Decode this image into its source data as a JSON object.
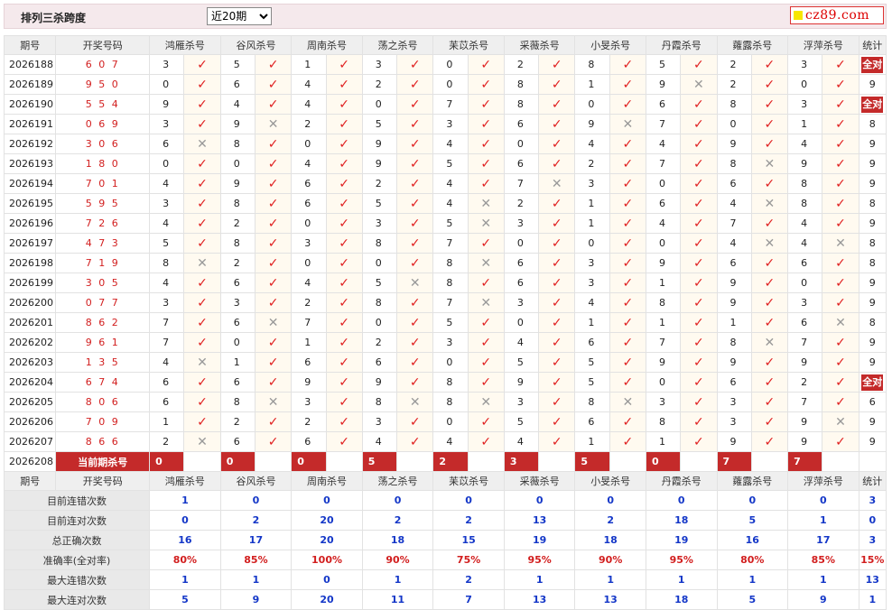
{
  "header": {
    "title": "排列三杀跨度",
    "period_select": "近20期",
    "logo_text": "cz89.com"
  },
  "columns": {
    "issue": "期号",
    "open": "开奖号码",
    "experts": [
      "鸿雁杀号",
      "谷风杀号",
      "周南杀号",
      "荡之杀号",
      "苿苡杀号",
      "采薇杀号",
      "小旻杀号",
      "丹霞杀号",
      "蕹露杀号",
      "浮萍杀号"
    ],
    "stat": "统计"
  },
  "rows": [
    {
      "issue": "2026188",
      "open": "6 0 7",
      "k": [
        [
          "3",
          1
        ],
        [
          "5",
          1
        ],
        [
          "1",
          1
        ],
        [
          "3",
          1
        ],
        [
          "0",
          1
        ],
        [
          "2",
          1
        ],
        [
          "8",
          1
        ],
        [
          "5",
          1
        ],
        [
          "2",
          1
        ],
        [
          "3",
          1
        ]
      ],
      "stat": "全对"
    },
    {
      "issue": "2026189",
      "open": "9 5 0",
      "k": [
        [
          "0",
          1
        ],
        [
          "6",
          1
        ],
        [
          "4",
          1
        ],
        [
          "2",
          1
        ],
        [
          "0",
          1
        ],
        [
          "8",
          1
        ],
        [
          "1",
          1
        ],
        [
          "9",
          0
        ],
        [
          "2",
          1
        ],
        [
          "0",
          1
        ]
      ],
      "stat": "9"
    },
    {
      "issue": "2026190",
      "open": "5 5 4",
      "k": [
        [
          "9",
          1
        ],
        [
          "4",
          1
        ],
        [
          "4",
          1
        ],
        [
          "0",
          1
        ],
        [
          "7",
          1
        ],
        [
          "8",
          1
        ],
        [
          "0",
          1
        ],
        [
          "6",
          1
        ],
        [
          "8",
          1
        ],
        [
          "3",
          1
        ]
      ],
      "stat": "全对"
    },
    {
      "issue": "2026191",
      "open": "0 6 9",
      "k": [
        [
          "3",
          1
        ],
        [
          "9",
          0
        ],
        [
          "2",
          1
        ],
        [
          "5",
          1
        ],
        [
          "3",
          1
        ],
        [
          "6",
          1
        ],
        [
          "9",
          0
        ],
        [
          "7",
          1
        ],
        [
          "0",
          1
        ],
        [
          "1",
          1
        ]
      ],
      "stat": "8"
    },
    {
      "issue": "2026192",
      "open": "3 0 6",
      "k": [
        [
          "6",
          0
        ],
        [
          "8",
          1
        ],
        [
          "0",
          1
        ],
        [
          "9",
          1
        ],
        [
          "4",
          1
        ],
        [
          "0",
          1
        ],
        [
          "4",
          1
        ],
        [
          "4",
          1
        ],
        [
          "9",
          1
        ],
        [
          "4",
          1
        ]
      ],
      "stat": "9"
    },
    {
      "issue": "2026193",
      "open": "1 8 0",
      "k": [
        [
          "0",
          1
        ],
        [
          "0",
          1
        ],
        [
          "4",
          1
        ],
        [
          "9",
          1
        ],
        [
          "5",
          1
        ],
        [
          "6",
          1
        ],
        [
          "2",
          1
        ],
        [
          "7",
          1
        ],
        [
          "8",
          0
        ],
        [
          "9",
          1
        ]
      ],
      "stat": "9"
    },
    {
      "issue": "2026194",
      "open": "7 0 1",
      "k": [
        [
          "4",
          1
        ],
        [
          "9",
          1
        ],
        [
          "6",
          1
        ],
        [
          "2",
          1
        ],
        [
          "4",
          1
        ],
        [
          "7",
          0
        ],
        [
          "3",
          1
        ],
        [
          "0",
          1
        ],
        [
          "6",
          1
        ],
        [
          "8",
          1
        ]
      ],
      "stat": "9"
    },
    {
      "issue": "2026195",
      "open": "5 9 5",
      "k": [
        [
          "3",
          1
        ],
        [
          "8",
          1
        ],
        [
          "6",
          1
        ],
        [
          "5",
          1
        ],
        [
          "4",
          0
        ],
        [
          "2",
          1
        ],
        [
          "1",
          1
        ],
        [
          "6",
          1
        ],
        [
          "4",
          0
        ],
        [
          "8",
          1
        ]
      ],
      "stat": "8"
    },
    {
      "issue": "2026196",
      "open": "7 2 6",
      "k": [
        [
          "4",
          1
        ],
        [
          "2",
          1
        ],
        [
          "0",
          1
        ],
        [
          "3",
          1
        ],
        [
          "5",
          0
        ],
        [
          "3",
          1
        ],
        [
          "1",
          1
        ],
        [
          "4",
          1
        ],
        [
          "7",
          1
        ],
        [
          "4",
          1
        ]
      ],
      "stat": "9"
    },
    {
      "issue": "2026197",
      "open": "4 7 3",
      "k": [
        [
          "5",
          1
        ],
        [
          "8",
          1
        ],
        [
          "3",
          1
        ],
        [
          "8",
          1
        ],
        [
          "7",
          1
        ],
        [
          "0",
          1
        ],
        [
          "0",
          1
        ],
        [
          "0",
          1
        ],
        [
          "4",
          0
        ],
        [
          "4",
          0
        ]
      ],
      "stat": "8"
    },
    {
      "issue": "2026198",
      "open": "7 1 9",
      "k": [
        [
          "8",
          0
        ],
        [
          "2",
          1
        ],
        [
          "0",
          1
        ],
        [
          "0",
          1
        ],
        [
          "8",
          0
        ],
        [
          "6",
          1
        ],
        [
          "3",
          1
        ],
        [
          "9",
          1
        ],
        [
          "6",
          1
        ],
        [
          "6",
          1
        ]
      ],
      "stat": "8"
    },
    {
      "issue": "2026199",
      "open": "3 0 5",
      "k": [
        [
          "4",
          1
        ],
        [
          "6",
          1
        ],
        [
          "4",
          1
        ],
        [
          "5",
          0
        ],
        [
          "8",
          1
        ],
        [
          "6",
          1
        ],
        [
          "3",
          1
        ],
        [
          "1",
          1
        ],
        [
          "9",
          1
        ],
        [
          "0",
          1
        ]
      ],
      "stat": "9"
    },
    {
      "issue": "2026200",
      "open": "0 7 7",
      "k": [
        [
          "3",
          1
        ],
        [
          "3",
          1
        ],
        [
          "2",
          1
        ],
        [
          "8",
          1
        ],
        [
          "7",
          0
        ],
        [
          "3",
          1
        ],
        [
          "4",
          1
        ],
        [
          "8",
          1
        ],
        [
          "9",
          1
        ],
        [
          "3",
          1
        ]
      ],
      "stat": "9"
    },
    {
      "issue": "2026201",
      "open": "8 6 2",
      "k": [
        [
          "7",
          1
        ],
        [
          "6",
          0
        ],
        [
          "7",
          1
        ],
        [
          "0",
          1
        ],
        [
          "5",
          1
        ],
        [
          "0",
          1
        ],
        [
          "1",
          1
        ],
        [
          "1",
          1
        ],
        [
          "1",
          1
        ],
        [
          "6",
          0
        ]
      ],
      "stat": "8"
    },
    {
      "issue": "2026202",
      "open": "9 6 1",
      "k": [
        [
          "7",
          1
        ],
        [
          "0",
          1
        ],
        [
          "1",
          1
        ],
        [
          "2",
          1
        ],
        [
          "3",
          1
        ],
        [
          "4",
          1
        ],
        [
          "6",
          1
        ],
        [
          "7",
          1
        ],
        [
          "8",
          0
        ],
        [
          "7",
          1
        ]
      ],
      "stat": "9"
    },
    {
      "issue": "2026203",
      "open": "1 3 5",
      "k": [
        [
          "4",
          0
        ],
        [
          "1",
          1
        ],
        [
          "6",
          1
        ],
        [
          "6",
          1
        ],
        [
          "0",
          1
        ],
        [
          "5",
          1
        ],
        [
          "5",
          1
        ],
        [
          "9",
          1
        ],
        [
          "9",
          1
        ],
        [
          "9",
          1
        ]
      ],
      "stat": "9"
    },
    {
      "issue": "2026204",
      "open": "6 7 4",
      "k": [
        [
          "6",
          1
        ],
        [
          "6",
          1
        ],
        [
          "9",
          1
        ],
        [
          "9",
          1
        ],
        [
          "8",
          1
        ],
        [
          "9",
          1
        ],
        [
          "5",
          1
        ],
        [
          "0",
          1
        ],
        [
          "6",
          1
        ],
        [
          "2",
          1
        ]
      ],
      "stat": "全对"
    },
    {
      "issue": "2026205",
      "open": "8 0 6",
      "k": [
        [
          "6",
          1
        ],
        [
          "8",
          0
        ],
        [
          "3",
          1
        ],
        [
          "8",
          0
        ],
        [
          "8",
          0
        ],
        [
          "3",
          1
        ],
        [
          "8",
          0
        ],
        [
          "3",
          1
        ],
        [
          "3",
          1
        ],
        [
          "7",
          1
        ]
      ],
      "stat": "6"
    },
    {
      "issue": "2026206",
      "open": "7 0 9",
      "k": [
        [
          "1",
          1
        ],
        [
          "2",
          1
        ],
        [
          "2",
          1
        ],
        [
          "3",
          1
        ],
        [
          "0",
          1
        ],
        [
          "5",
          1
        ],
        [
          "6",
          1
        ],
        [
          "8",
          1
        ],
        [
          "3",
          1
        ],
        [
          "9",
          0
        ]
      ],
      "stat": "9"
    },
    {
      "issue": "2026207",
      "open": "8 6 6",
      "k": [
        [
          "2",
          0
        ],
        [
          "6",
          1
        ],
        [
          "6",
          1
        ],
        [
          "4",
          1
        ],
        [
          "4",
          1
        ],
        [
          "4",
          1
        ],
        [
          "1",
          1
        ],
        [
          "1",
          1
        ],
        [
          "9",
          1
        ],
        [
          "9",
          1
        ]
      ],
      "stat": "9"
    }
  ],
  "current": {
    "issue": "2026208",
    "label": "当前期杀号",
    "values": [
      "0",
      "0",
      "0",
      "5",
      "2",
      "3",
      "5",
      "0",
      "7",
      "7"
    ]
  },
  "stats": [
    {
      "label": "目前连错次数",
      "values": [
        "1",
        "0",
        "0",
        "0",
        "0",
        "0",
        "0",
        "0",
        "0",
        "0",
        "3"
      ],
      "red": false
    },
    {
      "label": "目前连对次数",
      "values": [
        "0",
        "2",
        "20",
        "2",
        "2",
        "13",
        "2",
        "18",
        "5",
        "1",
        "0"
      ],
      "red": false
    },
    {
      "label": "总正确次数",
      "values": [
        "16",
        "17",
        "20",
        "18",
        "15",
        "19",
        "18",
        "19",
        "16",
        "17",
        "3"
      ],
      "red": false
    },
    {
      "label": "准确率(全对率)",
      "values": [
        "80%",
        "85%",
        "100%",
        "90%",
        "75%",
        "95%",
        "90%",
        "95%",
        "80%",
        "85%",
        "15%"
      ],
      "red": true
    },
    {
      "label": "最大连错次数",
      "values": [
        "1",
        "1",
        "0",
        "1",
        "2",
        "1",
        "1",
        "1",
        "1",
        "1",
        "13"
      ],
      "red": false
    },
    {
      "label": "最大连对次数",
      "values": [
        "5",
        "9",
        "20",
        "11",
        "7",
        "13",
        "13",
        "18",
        "5",
        "9",
        "1"
      ],
      "red": false
    }
  ],
  "marks": {
    "ok": "✓",
    "bad": "✕"
  },
  "colors": {
    "accent_red": "#c42a2a",
    "number_red": "#d21e1e",
    "stat_blue": "#1437c8",
    "header_bg": "#efefef"
  }
}
